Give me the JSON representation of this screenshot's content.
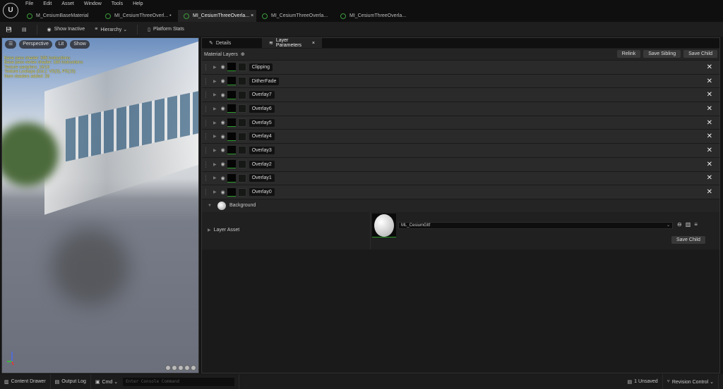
{
  "menu": [
    "File",
    "Edit",
    "Asset",
    "Window",
    "Tools",
    "Help"
  ],
  "tabs": [
    {
      "label": "M_CesiumBaseMaterial"
    },
    {
      "label": "MI_CesiumThreeOverl... •"
    },
    {
      "label": "MI_CesiumThreeOverla... ×"
    },
    {
      "label": "MI_CesiumThreeOverla..."
    },
    {
      "label": "MI_CesiumThreeOverla..."
    }
  ],
  "toolbar": {
    "show_inactive": "Show Inactive",
    "hierarchy": "Hierarchy ⌄",
    "platform_stats": "Platform Stats"
  },
  "viewport": {
    "perspective": "Perspective",
    "lit": "Lit",
    "show": "Show",
    "stats": [
      "Base pass shader: 585 instructions",
      "Base pass vertex shader: 160 instructions",
      "Texture samplers: 16/16",
      "Texture Lookups (Est.): VS(3), PS(15)",
      "Num shaders added: 28"
    ]
  },
  "panel": {
    "tab_details": "Details",
    "tab_layer_params": "Layer Parameters",
    "material_layers": "Material Layers",
    "relink": "Relink",
    "save_sibling": "Save Sibling",
    "save_child": "Save Child",
    "layers": [
      "Clipping",
      "DitherFade",
      "Overlay7",
      "Overlay6",
      "Overlay5",
      "Overlay4",
      "Overlay3",
      "Overlay2",
      "Overlay1",
      "Overlay0"
    ],
    "background": "Background",
    "layer_asset": "Layer Asset",
    "asset_value": "ML_CesiumGltf",
    "asset_save_child": "Save Child"
  },
  "status": {
    "content_drawer": "Content Drawer",
    "output_log": "Output Log",
    "cmd": "Cmd ⌄",
    "console_placeholder": "Enter Console Command",
    "unsaved": "1 Unsaved",
    "revision_control": "Revision Control ⌄"
  }
}
